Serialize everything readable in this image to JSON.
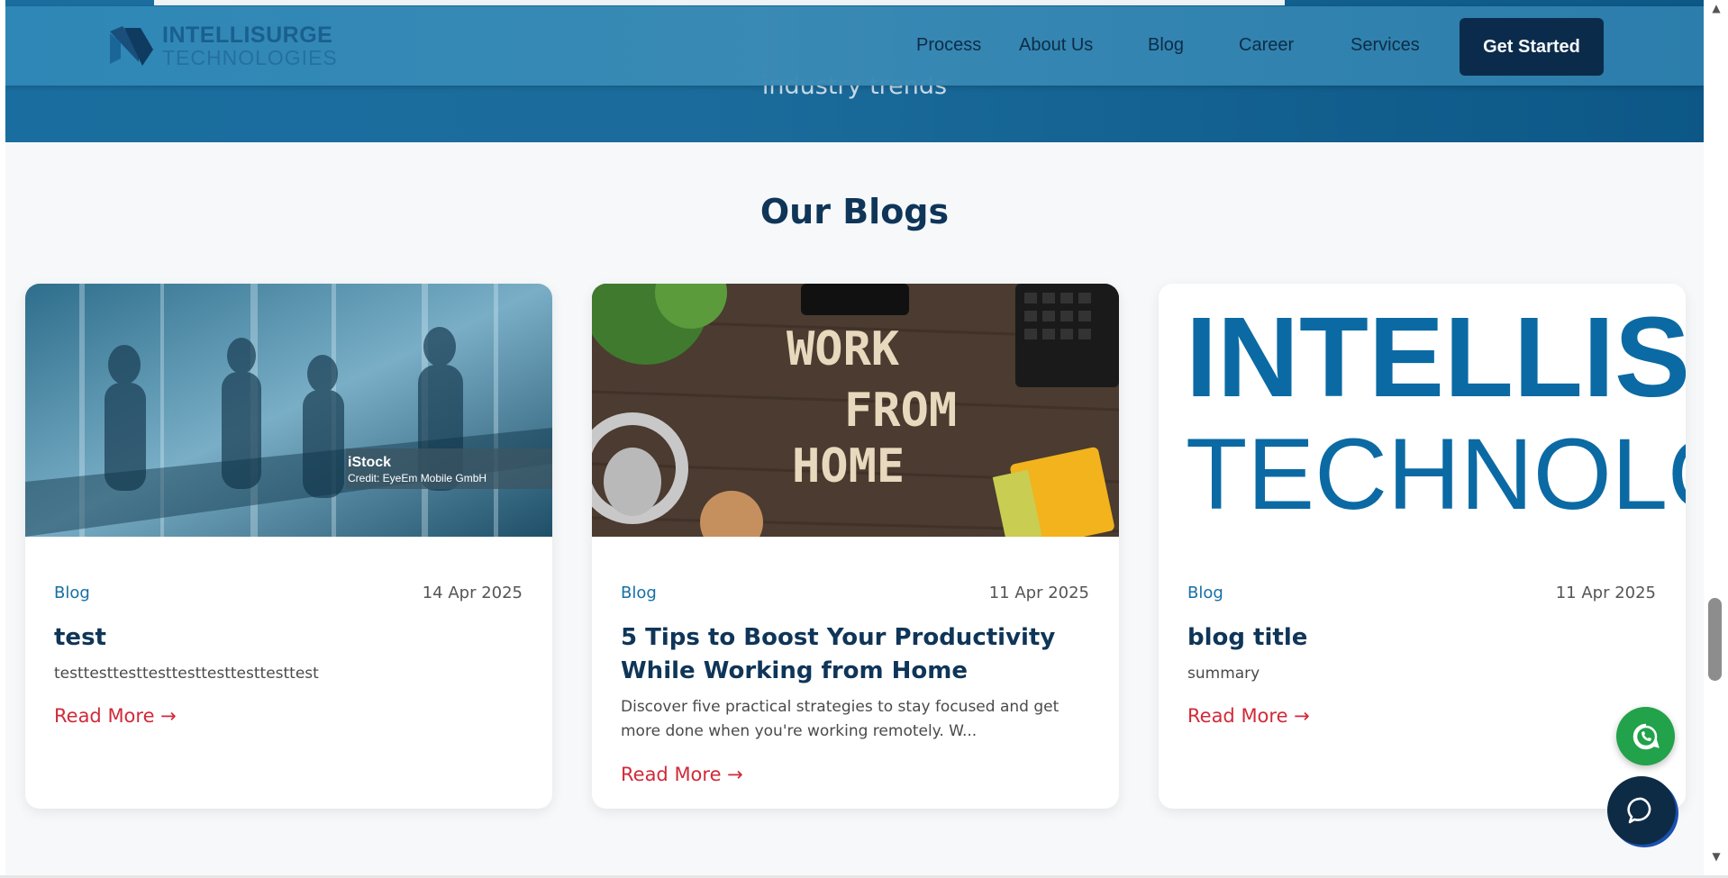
{
  "header": {
    "logo_line1": "INTELLISURGE",
    "logo_line2": "TECHNOLOGIES",
    "nav": [
      "Process",
      "About Us",
      "Blog",
      "Career",
      "Services"
    ],
    "cta_label": "Get Started"
  },
  "hero": {
    "subtitle": "industry trends"
  },
  "section": {
    "title": "Our Blogs"
  },
  "cards": [
    {
      "category": "Blog",
      "date": "14 Apr 2025",
      "title": "test",
      "summary": "testtesttesttesttesttesttesttesttest",
      "read_more": "Read More →",
      "image_caption_brand": "iStock",
      "image_caption_credit": "Credit: EyeEm Mobile GmbH"
    },
    {
      "category": "Blog",
      "date": "11 Apr 2025",
      "title": "5 Tips to Boost Your Productivity While Working from Home",
      "summary": "Discover five practical strategies to stay focused and get more done when you're working remotely. W...",
      "read_more": "Read More →",
      "image_words": [
        "WORK",
        "FROM",
        "HOME"
      ]
    },
    {
      "category": "Blog",
      "date": "11 Apr 2025",
      "title": "blog title",
      "summary": "summary",
      "read_more": "Read More →",
      "image_text_line1": "INTELLISURGE",
      "image_text_line2": "TECHNOLOGIES"
    }
  ],
  "floating": {
    "whatsapp_icon": "whatsapp-icon",
    "chat_icon": "chat-bubble-icon"
  },
  "colors": {
    "navy": "#0f3558",
    "accent_blue": "#166fa6",
    "read_more_red": "#d12a39",
    "whatsapp_green": "#22a24a"
  }
}
